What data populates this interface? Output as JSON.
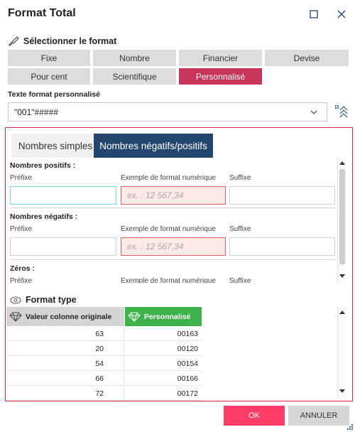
{
  "dialog": {
    "title": "Format Total"
  },
  "select_format": {
    "label": "Sélectionner le format",
    "buttons": [
      "Fixe",
      "Nombre",
      "Financier",
      "Devise",
      "Pour cent",
      "Scientifique",
      "Personnalisé"
    ],
    "active": "Personnalisé"
  },
  "custom_format": {
    "label": "Texte format personnalisé",
    "value": "\"001\"#####"
  },
  "tabs": {
    "simple": "Nombres simples",
    "neg_pos": "Nombres négatifs/positifs",
    "active": "Nombres négatifs/positifs"
  },
  "groups": {
    "positive": {
      "title": "Nombres positifs :",
      "prefix_label": "Préfixe",
      "example_label": "Exemple de format numérique",
      "suffix_label": "Suffixe",
      "prefix": "",
      "example_placeholder": "ex. : 12 567,34",
      "suffix": ""
    },
    "negative": {
      "title": "Nombres négatifs :",
      "prefix_label": "Préfixe",
      "example_label": "Exemple de format numérique",
      "suffix_label": "Suffixe",
      "prefix": "",
      "example_placeholder": "ex. : 12 567,34",
      "suffix": ""
    },
    "zeros": {
      "title": "Zéros :",
      "prefix_label": "Préfixe",
      "example_label": "Exemple de format numérique",
      "suffix_label": "Suffixe"
    }
  },
  "format_type": {
    "label": "Format type",
    "columns": {
      "original": "Valeur colonne originale",
      "custom": "Personnalisé"
    },
    "rows": [
      {
        "original": "63",
        "custom": "00163"
      },
      {
        "original": "20",
        "custom": "00120"
      },
      {
        "original": "54",
        "custom": "00154"
      },
      {
        "original": "66",
        "custom": "00166"
      },
      {
        "original": "72",
        "custom": "00172"
      },
      {
        "original": "",
        "custom": ""
      }
    ]
  },
  "actions": {
    "ok": "OK",
    "cancel": "ANNULER"
  },
  "icons": [
    "maximize-icon",
    "close-icon",
    "brush-icon",
    "chevron-down-icon",
    "format-tools-icon",
    "scroll-up-icon",
    "scroll-down-icon",
    "eye-icon",
    "diamond-icon",
    "resize-grip-icon"
  ],
  "colors": {
    "accent": "#c8355b",
    "tab_active": "#24466e",
    "custom_col": "#3db24a",
    "ok": "#ff3d67",
    "panel_border": "#d9283c"
  }
}
